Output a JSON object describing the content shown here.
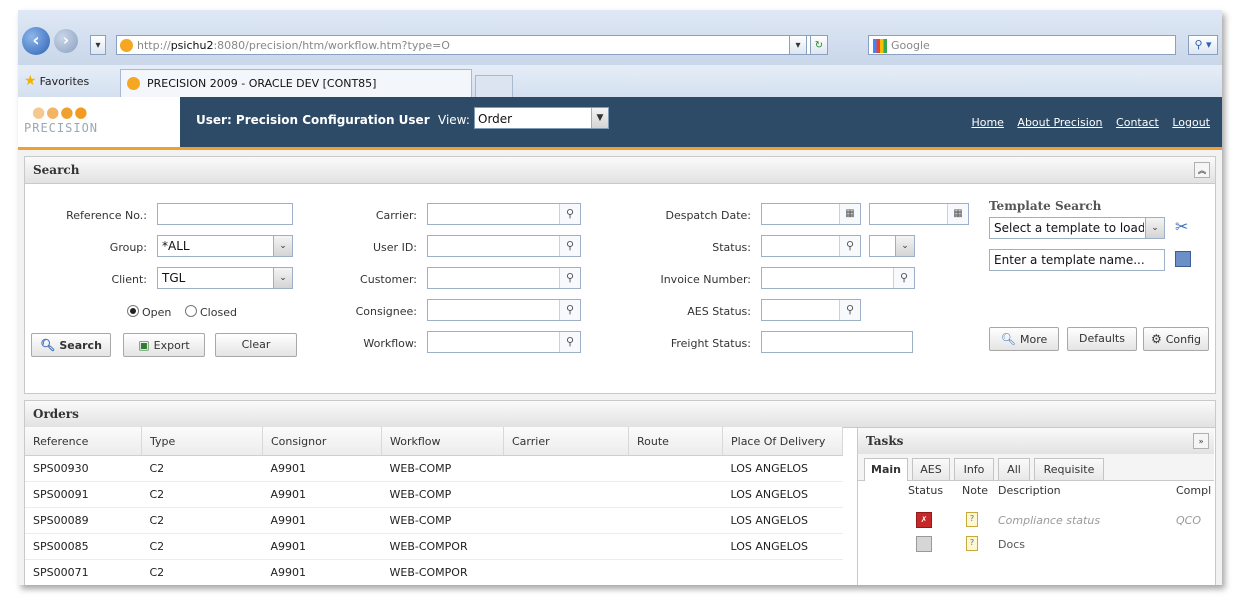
{
  "browser": {
    "url_prefix": "http://",
    "url_host": "psichu2",
    "url_rest": ":8080/precision/htm/workflow.htm?type=O",
    "search_placeholder": "Google",
    "favorites_label": "Favorites",
    "tab_title": "PRECISION 2009 - ORACLE DEV [CONT85]"
  },
  "header": {
    "logo_text": "PRECISION",
    "user_label": "User: Precision Configuration User",
    "view_label": "View:",
    "view_value": "Order",
    "links": [
      "Home",
      "About Precision",
      "Contact",
      "Logout"
    ]
  },
  "search": {
    "title": "Search",
    "reference_label": "Reference No.:",
    "reference_value": "",
    "group_label": "Group:",
    "group_value": "*ALL",
    "client_label": "Client:",
    "client_value": "TGL",
    "open_label": "Open",
    "closed_label": "Closed",
    "carrier_label": "Carrier:",
    "userid_label": "User ID:",
    "customer_label": "Customer:",
    "consignee_label": "Consignee:",
    "workflow_label": "Workflow:",
    "despatch_label": "Despatch Date:",
    "status_label": "Status:",
    "invoice_label": "Invoice Number:",
    "aes_label": "AES Status:",
    "freight_label": "Freight Status:",
    "search_btn": "Search",
    "export_btn": "Export",
    "clear_btn": "Clear",
    "template_title": "Template Search",
    "template_select": "Select a template to load",
    "template_name": "Enter a template name...",
    "more_btn": "More",
    "defaults_btn": "Defaults",
    "config_btn": "Config"
  },
  "orders": {
    "title": "Orders",
    "columns": [
      "Reference",
      "Type",
      "Consignor",
      "Workflow",
      "Carrier",
      "Route",
      "Place Of Delivery"
    ],
    "rows": [
      [
        "SPS00930",
        "C2",
        "A9901",
        "WEB-COMP",
        "",
        "",
        "LOS ANGELOS"
      ],
      [
        "SPS00091",
        "C2",
        "A9901",
        "WEB-COMP",
        "",
        "",
        "LOS ANGELOS"
      ],
      [
        "SPS00089",
        "C2",
        "A9901",
        "WEB-COMP",
        "",
        "",
        "LOS ANGELOS"
      ],
      [
        "SPS00085",
        "C2",
        "A9901",
        "WEB-COMPOR",
        "",
        "",
        "LOS ANGELOS"
      ],
      [
        "SPS00071",
        "C2",
        "A9901",
        "WEB-COMPOR",
        "",
        "",
        ""
      ]
    ]
  },
  "tasks": {
    "title": "Tasks",
    "tabs": [
      "Main",
      "AES",
      "Info",
      "All",
      "Requisite"
    ],
    "columns": [
      "Status",
      "Note",
      "Description",
      "Compl"
    ],
    "rows": [
      {
        "description": "Compliance status",
        "compl": "QCO"
      },
      {
        "description": "Docs",
        "compl": ""
      }
    ]
  }
}
